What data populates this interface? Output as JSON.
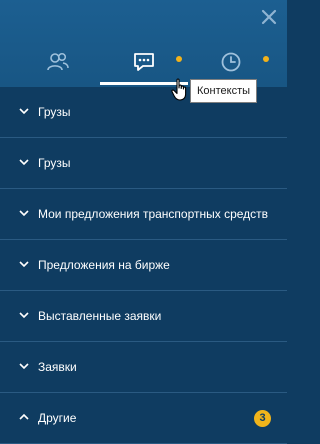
{
  "tabs": [
    {
      "icon": "users-icon",
      "name": "contacts"
    },
    {
      "icon": "chat-icon",
      "name": "contexts",
      "active": true,
      "tooltip": "Контексты"
    },
    {
      "icon": "clock-icon",
      "name": "history"
    }
  ],
  "tooltip": {
    "text": "Контексты"
  },
  "sections": [
    {
      "label": "Грузы",
      "expanded": false
    },
    {
      "label": "Грузы",
      "expanded": false
    },
    {
      "label": "Мои предложения транспортных средств",
      "expanded": false
    },
    {
      "label": "Предложения на бирже",
      "expanded": false
    },
    {
      "label": "Выставленные заявки",
      "expanded": false
    },
    {
      "label": "Заявки",
      "expanded": false
    },
    {
      "label": "Другие",
      "expanded": true,
      "badge": "3"
    }
  ],
  "colors": {
    "panel_bg": "#0f3c61",
    "header_bg": "#1c5f91",
    "accent_dot": "#f2b21b",
    "badge": "#f0b41b",
    "divider": "#2a5a82"
  }
}
